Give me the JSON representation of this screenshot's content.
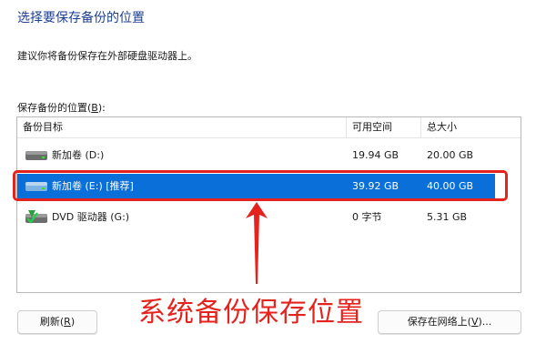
{
  "page": {
    "heading": "选择要保存备份的位置",
    "advice": "建议你将备份保存在外部硬盘驱动器上。",
    "list_label_text": "保存备份的位置(",
    "list_label_key": "B",
    "list_label_tail": "):"
  },
  "table": {
    "columns": [
      "备份目标",
      "可用空间",
      "总大小"
    ],
    "rows": [
      {
        "name": "新加卷 (D:)",
        "free": "19.94 GB",
        "total": "20.00 GB",
        "icon": "hard-drive-icon",
        "selected": false
      },
      {
        "name": "新加卷 (E:) [推荐]",
        "free": "39.92 GB",
        "total": "40.00 GB",
        "icon": "hard-drive-icon",
        "selected": true
      },
      {
        "name": "DVD 驱动器 (G:)",
        "free": "0 字节",
        "total": "5.31 GB",
        "icon": "dvd-drive-icon",
        "selected": false
      }
    ]
  },
  "annotation": {
    "text": "系统备份保存位置",
    "color": "#e5231e"
  },
  "buttons": {
    "refresh_text": "刷新(",
    "refresh_key": "R",
    "refresh_tail": ")",
    "network_text": "保存在网络上(",
    "network_key": "V",
    "network_tail": ")..."
  },
  "colors": {
    "selection": "#0a6fd8",
    "heading": "#1c3f94"
  }
}
